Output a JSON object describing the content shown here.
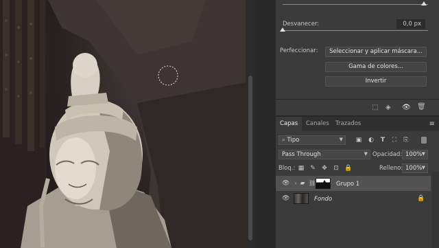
{
  "properties": {
    "desvanecer_label": "Desvanecer:",
    "desvanecer_value": "0,0 px",
    "perfeccionar_label": "Perfeccionar:",
    "btn_select_mask": "Seleccionar y aplicar máscara...",
    "btn_color_range": "Gama de colores...",
    "btn_invert": "Invertir"
  },
  "layers": {
    "tabs": [
      "Capas",
      "Canales",
      "Trazados"
    ],
    "filter_kind": "Tipo",
    "blend_mode": "Pass Through",
    "opacity_label": "Opacidad:",
    "opacity_value": "100%",
    "lock_label": "Bloq.:",
    "fill_label": "Relleno:",
    "fill_value": "100%",
    "items": [
      {
        "name": "Grupo 1",
        "type": "group",
        "selected": true
      },
      {
        "name": "Fondo",
        "type": "image",
        "selected": false,
        "locked": true
      }
    ]
  },
  "colors": {
    "panel_bg": "#3b3b3b",
    "selected_row": "#525252"
  }
}
